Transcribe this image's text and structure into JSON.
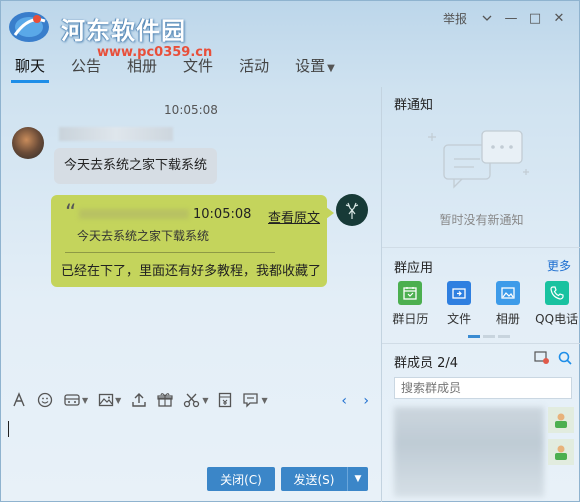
{
  "watermark": {
    "site_name": "河东软件园",
    "site_url": "www.pc0359.cn"
  },
  "window": {
    "report_label": "举报",
    "min_glyph": "—",
    "max_glyph": "□",
    "close_glyph": "✕"
  },
  "tabs": [
    {
      "label": "聊天"
    },
    {
      "label": "公告"
    },
    {
      "label": "相册"
    },
    {
      "label": "文件"
    },
    {
      "label": "活动"
    },
    {
      "label": "设置"
    }
  ],
  "chat": {
    "timestamp": "10:05:08",
    "messages": [
      {
        "side": "left",
        "text": "今天去系统之家下载系统"
      },
      {
        "side": "right",
        "quote_time": "10:05:08",
        "quote_link": "查看原文",
        "quote_text": "今天去系统之家下载系统",
        "reply": "已经在下了，里面还有好多教程，我都收藏了"
      }
    ]
  },
  "toolbar": {
    "nav_glyph": "‹ ›"
  },
  "buttons": {
    "close_label": "关闭(C)",
    "send_label": "发送(S)",
    "send_dd_glyph": "▼"
  },
  "right_panel": {
    "notice_title": "群通知",
    "notice_empty": "暂时没有新通知",
    "apps_title": "群应用",
    "apps_more": "更多",
    "apps": [
      {
        "label": "群日历",
        "icon": "calendar-icon",
        "color": "#4caf50"
      },
      {
        "label": "文件",
        "icon": "folder-icon",
        "color": "#2f7fe0"
      },
      {
        "label": "相册",
        "icon": "photo-icon",
        "color": "#3d9be9"
      },
      {
        "label": "QQ电话",
        "icon": "phone-icon",
        "color": "#19c2a0"
      }
    ],
    "members_title": "群成员 2/4",
    "member_search_placeholder": "搜索群成员"
  },
  "colors": {
    "accent": "#1e8ee8",
    "bubble_right": "#c4d45c",
    "button": "#3b86c8"
  }
}
